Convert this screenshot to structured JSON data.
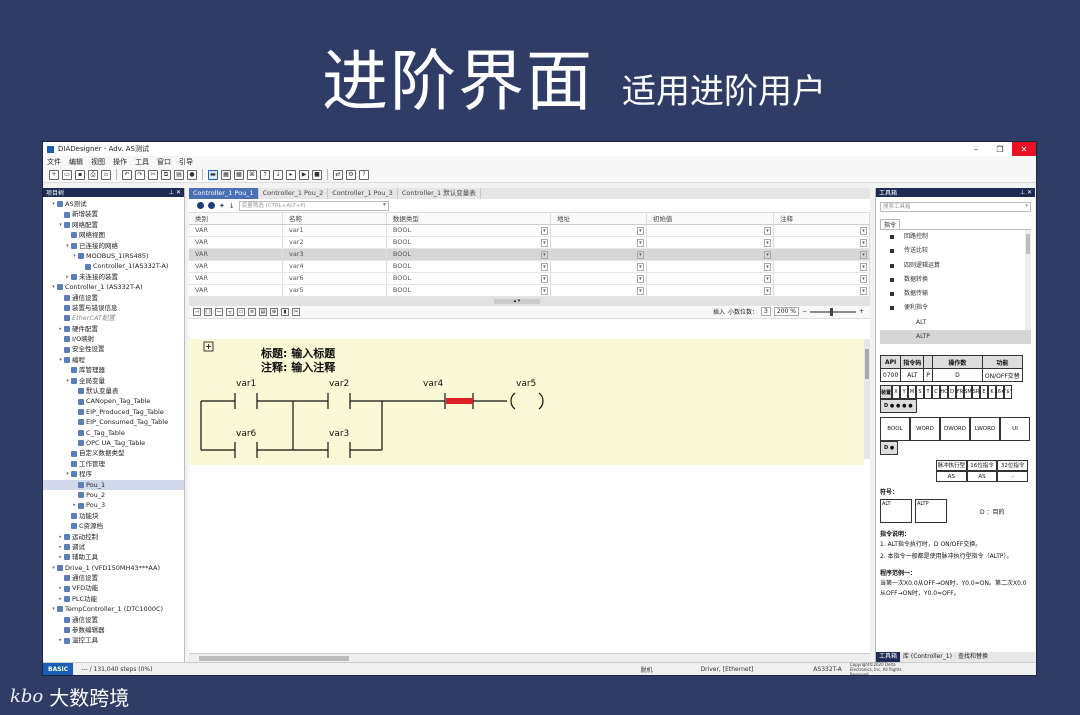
{
  "slide": {
    "title": "进阶界面",
    "subtitle": "适用进阶用户",
    "brand": "大数跨境",
    "brand_logo": "kbo"
  },
  "window": {
    "title": "DIADesigner  - Adv.  AS测试",
    "menu": [
      "文件",
      "编辑",
      "视图",
      "操作",
      "工具",
      "窗口",
      "引导"
    ]
  },
  "project": {
    "header": "项目树",
    "tree": [
      {
        "d": 1,
        "t": "▾",
        "label": "AS测试"
      },
      {
        "d": 2,
        "t": "",
        "label": "新增装置"
      },
      {
        "d": 2,
        "t": "▾",
        "label": "网络配置"
      },
      {
        "d": 3,
        "t": "",
        "label": "网络视图"
      },
      {
        "d": 3,
        "t": "▾",
        "label": "已连接的网络"
      },
      {
        "d": 4,
        "t": "▾",
        "label": "MODBUS_1(RS485)"
      },
      {
        "d": 5,
        "t": "",
        "label": "Controller_1(AS332T-A)"
      },
      {
        "d": 3,
        "t": "▸",
        "label": "未连接的装置"
      },
      {
        "d": 1,
        "t": "▾",
        "label": "Controller_1 (AS332T-A)"
      },
      {
        "d": 2,
        "t": "",
        "label": "通信设置"
      },
      {
        "d": 2,
        "t": "",
        "label": "装置与错误信息"
      },
      {
        "d": 2,
        "t": "",
        "label": "EtherCAT配置",
        "italic": true
      },
      {
        "d": 2,
        "t": "▸",
        "label": "硬件配置"
      },
      {
        "d": 2,
        "t": "",
        "label": "I/O映射"
      },
      {
        "d": 2,
        "t": "",
        "label": "安全性设置"
      },
      {
        "d": 2,
        "t": "▾",
        "label": "编程"
      },
      {
        "d": 3,
        "t": "",
        "label": "库管理器"
      },
      {
        "d": 3,
        "t": "▾",
        "label": "全局变量"
      },
      {
        "d": 4,
        "t": "",
        "label": "默认变量表"
      },
      {
        "d": 4,
        "t": "",
        "label": "CANopen_Tag_Table"
      },
      {
        "d": 4,
        "t": "",
        "label": "EIP_Produced_Tag_Table"
      },
      {
        "d": 4,
        "t": "",
        "label": "EIP_Consumed_Tag_Table"
      },
      {
        "d": 4,
        "t": "",
        "label": "C_Tag_Table"
      },
      {
        "d": 4,
        "t": "",
        "label": "OPC UA_Tag_Table"
      },
      {
        "d": 3,
        "t": "",
        "label": "自定义数据类型"
      },
      {
        "d": 3,
        "t": "",
        "label": "工作管理"
      },
      {
        "d": 3,
        "t": "▾",
        "label": "程序"
      },
      {
        "d": 4,
        "t": "",
        "label": "Pou_1",
        "sel": true
      },
      {
        "d": 4,
        "t": "",
        "label": "Pou_2"
      },
      {
        "d": 4,
        "t": "▸",
        "label": "Pou_3"
      },
      {
        "d": 3,
        "t": "",
        "label": "功能块"
      },
      {
        "d": 3,
        "t": "",
        "label": "C资源档"
      },
      {
        "d": 2,
        "t": "▸",
        "label": "运动控制"
      },
      {
        "d": 2,
        "t": "▸",
        "label": "调试"
      },
      {
        "d": 2,
        "t": "▸",
        "label": "辅助工具"
      },
      {
        "d": 1,
        "t": "▾",
        "label": "Drive_1 (VFD150MH43***AA)"
      },
      {
        "d": 2,
        "t": "",
        "label": "通信设置"
      },
      {
        "d": 2,
        "t": "▸",
        "label": "VFD功能"
      },
      {
        "d": 2,
        "t": "▸",
        "label": "PLC功能"
      },
      {
        "d": 1,
        "t": "▾",
        "label": "TempController_1 (DTC1000C)"
      },
      {
        "d": 2,
        "t": "",
        "label": "通信设置"
      },
      {
        "d": 2,
        "t": "",
        "label": "参数编辑器"
      },
      {
        "d": 2,
        "t": "▸",
        "label": "温控工具"
      }
    ]
  },
  "tabs": [
    "Controller_1 Pou_1",
    "Controller_1 Pou_2",
    "Controller_1 Pou_3",
    "Controller_1 默认变量表"
  ],
  "filter_placeholder": "变量筛选 (CTRL+ALT+F)",
  "var_table": {
    "headers": [
      "类别",
      "名称",
      "数据类型",
      "地址",
      "初始值",
      "注释"
    ],
    "rows": [
      [
        "VAR",
        "var1",
        "BOOL",
        "",
        "",
        ""
      ],
      [
        "VAR",
        "var2",
        "BOOL",
        "",
        "",
        ""
      ],
      [
        "VAR",
        "var3",
        "BOOL",
        "",
        "",
        ""
      ],
      [
        "VAR",
        "var4",
        "BOOL",
        "",
        "",
        ""
      ],
      [
        "VAR",
        "var6",
        "BOOL",
        "",
        "",
        ""
      ],
      [
        "VAR",
        "var5",
        "BOOL",
        "",
        "",
        ""
      ]
    ]
  },
  "ladder_tools": {
    "insert": "插入",
    "decimals_label": "小数位数：",
    "decimals": "3",
    "zoom": "200 %"
  },
  "ladder": {
    "title": "标题: 输入标题",
    "comment": "注释: 输入注释",
    "contacts": [
      "var1",
      "var2",
      "var4",
      "var6",
      "var3"
    ],
    "coil": "var5"
  },
  "toolbox": {
    "header": "工具箱",
    "search": "搜索工具箱",
    "tab": "指令",
    "items": [
      "回路控制",
      "传送比较",
      "四则逻辑运算",
      "数据转换",
      "数据传输",
      "便利指令",
      "ALT",
      "ALTP"
    ],
    "api_headers": [
      "API",
      "指令码",
      "",
      "操作数",
      "功能"
    ],
    "api_row": [
      "0700",
      "ALT",
      "P",
      "D",
      "ON/OFF交替"
    ],
    "ops_label": "装置",
    "ops_cols": [
      "X",
      "Y",
      "M",
      "S",
      "T",
      "C",
      "HC",
      "D",
      "FR",
      "SM",
      "SR",
      "E",
      "K",
      "16#",
      "\"$\""
    ],
    "ops_marks": "D ● ● ● ●",
    "dtypes": [
      "BOOL",
      "WORD",
      "DWORD",
      "LWORD",
      "UI"
    ],
    "dtype_row": "D  ●",
    "exec_headers": [
      "脉冲执行型",
      "16位指令",
      "32位指令"
    ],
    "exec_vals": [
      "AS",
      "AS",
      "-"
    ],
    "symbol_label": "符号：",
    "symbol_note": "D ：目的",
    "sym1": "ALT",
    "sym2": "ALTP",
    "desc_title": "指令说明：",
    "desc": [
      "1. ALT指令执行时，D ON/OFF交换。",
      "2. 本指令一般都是使用脉冲执行型指令（ALTP）。"
    ],
    "ex_title": "程序范例一：",
    "ex": "当第一次X0.0从OFF→ON时，Y0.0=ON。第二次X0.0从OFF→ON时，Y0.0=OFF。",
    "bottom_tabs": [
      "工具箱",
      "库 (Controller_1)",
      "查找和替换"
    ]
  },
  "status": {
    "mode": "BASIC",
    "steps": "--- / 131,040 steps (0%)",
    "state": "脱机",
    "driver": "Driver, [Ethernet]",
    "model": "AS332T-A",
    "copyright": "Copyright©2020 Delta Electronics, Inc. All Rights Reserved"
  },
  "colors": {
    "background": "#2f3c66",
    "panel_header": "#1d2c55",
    "ladder_bg": "#fbf8d6",
    "active_tab": "#4a6fb5",
    "status_blue": "#1a5fb4"
  }
}
